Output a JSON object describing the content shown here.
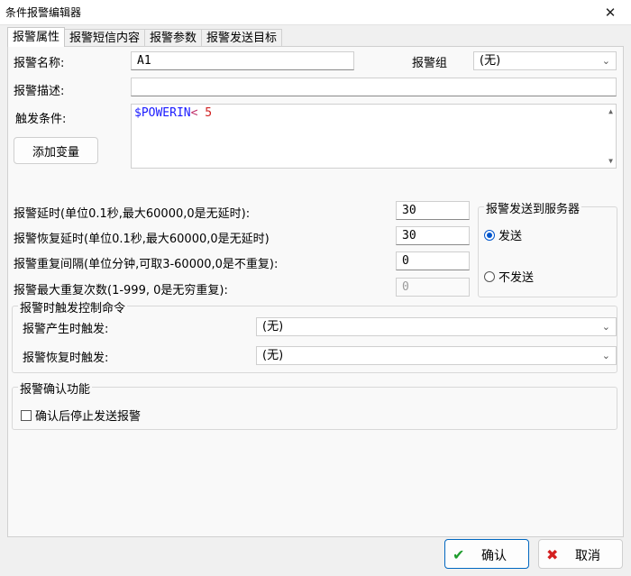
{
  "window": {
    "title": "条件报警编辑器",
    "close_glyph": "✕"
  },
  "tabs": [
    {
      "label": "报警属性",
      "active": true
    },
    {
      "label": "报警短信内容"
    },
    {
      "label": "报警参数"
    },
    {
      "label": "报警发送目标"
    }
  ],
  "form": {
    "name_label": "报警名称:",
    "name_value": "A1",
    "group_label": "报警组",
    "group_value": "(无)",
    "desc_label": "报警描述:",
    "desc_value": "",
    "condition_label": "触发条件:",
    "condition_tokens": {
      "var": "$POWERIN",
      "op": "<",
      "num": "5"
    },
    "add_var_button": "添加变量"
  },
  "timing": {
    "delay_label": "报警延时(单位0.1秒,最大60000,0是无延时):",
    "delay_value": "30",
    "recover_label": "报警恢复延时(单位0.1秒,最大60000,0是无延时)",
    "recover_value": "30",
    "repeat_interval_label": "报警重复间隔(单位分钟,可取3-60000,0是不重复):",
    "repeat_interval_value": "0",
    "max_repeat_label": "报警最大重复次数(1-999, 0是无穷重复):",
    "max_repeat_value": "0"
  },
  "server": {
    "group_title": "报警发送到服务器",
    "send_label": "发送",
    "nosend_label": "不发送",
    "selected": "send"
  },
  "control": {
    "group_title": "报警时触发控制命令",
    "on_alarm_label": "报警产生时触发:",
    "on_alarm_value": "(无)",
    "on_recover_label": "报警恢复时触发:",
    "on_recover_value": "(无)"
  },
  "confirm": {
    "group_title": "报警确认功能",
    "stop_after_confirm_label": "确认后停止发送报警",
    "checked": false
  },
  "footer": {
    "ok_label": "确认",
    "cancel_label": "取消"
  },
  "icons": {
    "ok": "check-icon",
    "cancel": "cross-icon",
    "ok_color": "#1f9d2e",
    "cancel_color": "#d42020"
  }
}
